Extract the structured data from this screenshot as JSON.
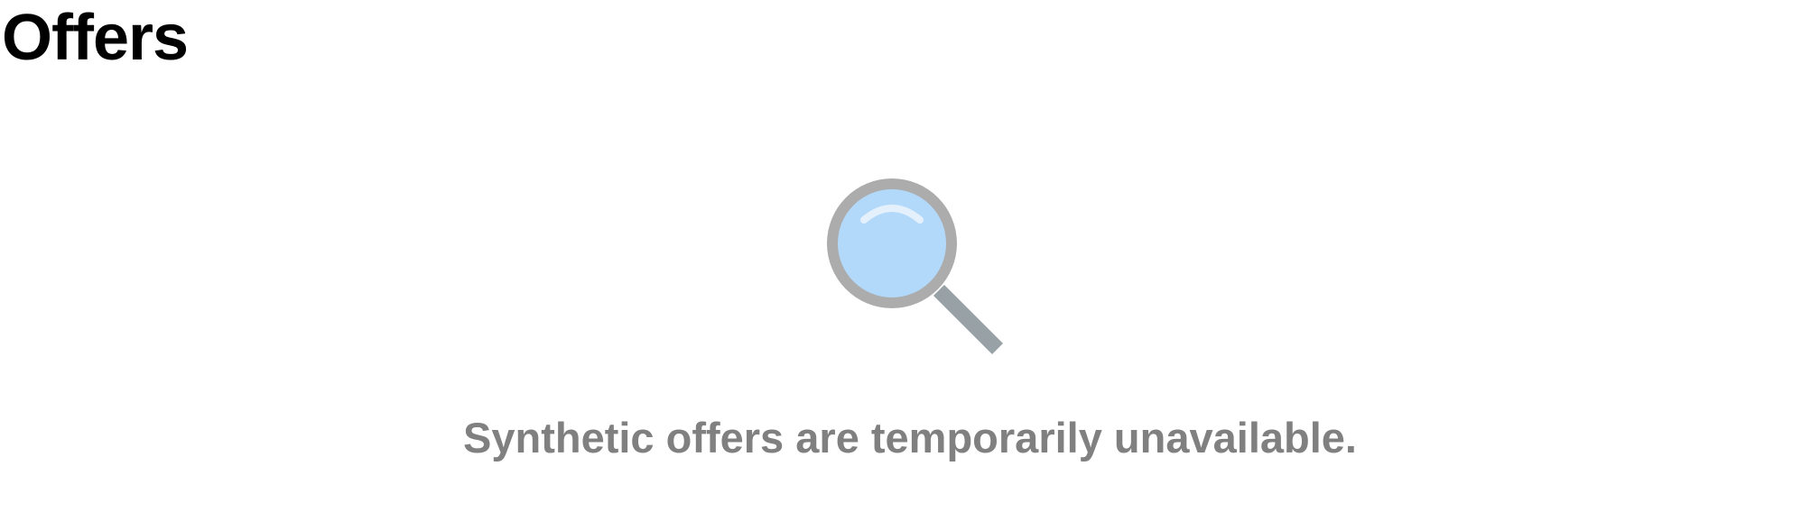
{
  "header": {
    "title": "Offers"
  },
  "empty_state": {
    "icon": "magnifying-glass-icon",
    "message": "Synthetic offers are temporarily unavailable."
  },
  "colors": {
    "title": "#000000",
    "message": "#808080",
    "lens_fill": "#b3d9fa",
    "lens_ring": "#acacac",
    "handle": "#98a1a6"
  }
}
